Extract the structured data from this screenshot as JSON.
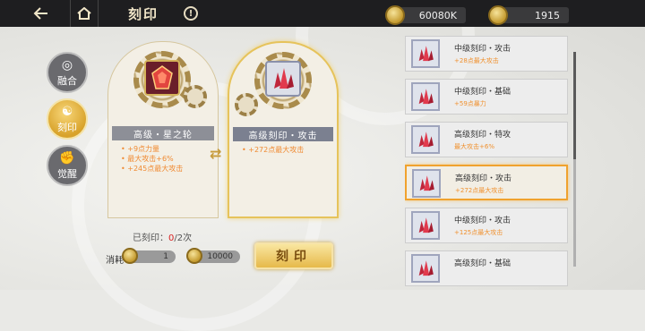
{
  "header": {
    "title": "刻印",
    "info_symbol": "!",
    "gold_amount": "60080K",
    "gem_amount": "1915"
  },
  "tabs": [
    {
      "label": "融合",
      "icon": "fusion-icon",
      "active": false
    },
    {
      "label": "刻印",
      "icon": "engrave-icon",
      "active": true
    },
    {
      "label": "觉醒",
      "icon": "awaken-icon",
      "active": false
    }
  ],
  "current_card": {
    "name": "高级・星之轮",
    "stats": [
      "+9点力量",
      "最大攻击+6%",
      "+245点最大攻击"
    ]
  },
  "target_card": {
    "name": "高级刻印・攻击",
    "stats": [
      "+272点最大攻击"
    ]
  },
  "engrave_status": {
    "label": "已刻印：",
    "used": "0",
    "total": "/2次"
  },
  "cost": {
    "label": "消耗",
    "item_count": "1",
    "gold": "10000"
  },
  "engrave_button": "刻印",
  "list": [
    {
      "name": "中级刻印・攻击",
      "desc": "+28点最大攻击",
      "selected": false
    },
    {
      "name": "中级刻印・基础",
      "desc": "+59点暴力",
      "selected": false
    },
    {
      "name": "高级刻印・特攻",
      "desc": "最大攻击+6%",
      "selected": false
    },
    {
      "name": "高级刻印・攻击",
      "desc": "+272点最大攻击",
      "selected": true
    },
    {
      "name": "中级刻印・攻击",
      "desc": "+125点最大攻击",
      "selected": false
    },
    {
      "name": "高级刻印・基础",
      "desc": "",
      "selected": false
    }
  ],
  "colors": {
    "accent_gold": "#e6b94a",
    "stat_orange": "#f08a32",
    "selected_border": "#f0a22e",
    "used_count_red": "#d82222"
  }
}
